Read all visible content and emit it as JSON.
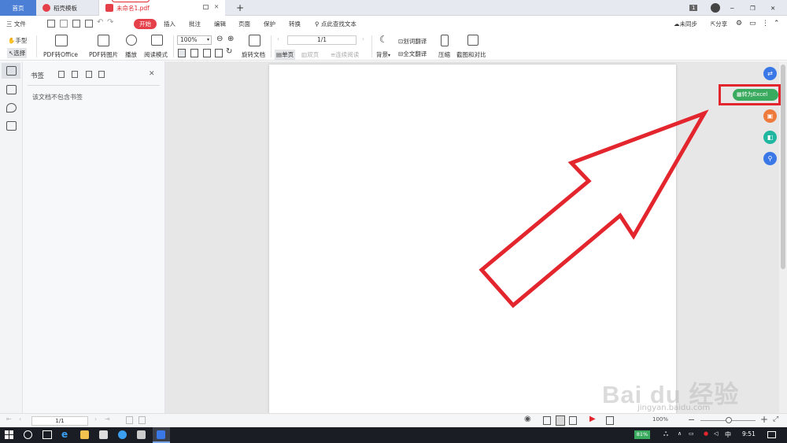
{
  "tabs": {
    "home": "首页",
    "templates": "稻壳模板",
    "document": "未命名1.pdf",
    "new_tab": "+"
  },
  "title_right": {
    "badge": "1",
    "minimize": "─",
    "restore": "❐",
    "close": "✕"
  },
  "menubar": {
    "file": "三 文件",
    "items": [
      "开始",
      "插入",
      "批注",
      "编辑",
      "页面",
      "保护",
      "转换"
    ],
    "search": "点此查找文本",
    "sync": "未同步",
    "share": "分享"
  },
  "ribbon": {
    "hand": "手型",
    "select": "选择",
    "pdf_to_office": "PDF转Office",
    "pdf_to_image": "PDF转图片",
    "play": "播放",
    "read_mode": "阅读模式",
    "zoom": "100%",
    "rotate": "旋转文档",
    "page_value": "1/1",
    "single_page": "单页",
    "double_page": "双页",
    "continuous": "连续阅读",
    "background": "背景",
    "word_translate": "划词翻译",
    "full_translate": "全文翻译",
    "compress": "压缩",
    "screenshot_compare": "截图和对比"
  },
  "bookmarks": {
    "title": "书签",
    "empty": "该文档不包含书签",
    "close": "✕"
  },
  "annotation": {
    "convert_excel": "转为Excel"
  },
  "statusbar": {
    "page": "1/1",
    "zoom": "100%"
  },
  "watermark": {
    "brand": "Bai du 经验",
    "url": "jingyan.baidu.com"
  },
  "taskbar": {
    "battery": "81%",
    "ime": "中",
    "time": "9:51"
  },
  "colors": {
    "accent_red": "#e0262d",
    "start_red": "#e5404a",
    "home_blue": "#4b7fd6",
    "excel_green": "#3aaa5e",
    "arrow_red": "#e3262e"
  }
}
